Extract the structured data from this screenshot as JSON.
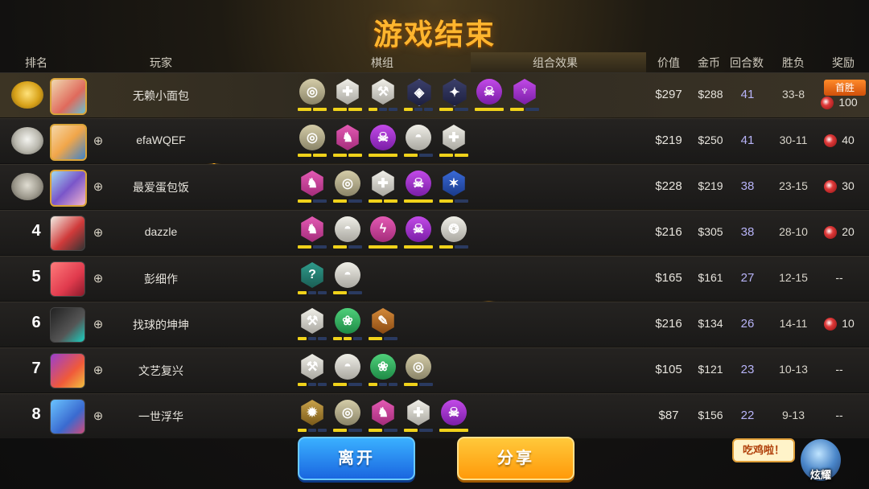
{
  "title": "游戏结束",
  "headers": {
    "rank": "排名",
    "player": "玩家",
    "pieces": "棋组",
    "combo": "组合效果",
    "value": "价值",
    "gold": "金币",
    "rounds": "回合数",
    "winloss": "胜负",
    "reward": "奖励"
  },
  "players": [
    {
      "rank": "1",
      "name": "无赖小面包",
      "value": "$297",
      "gold": "$288",
      "rounds": "41",
      "winloss": "33-8",
      "reward": "100",
      "first_win": "首胜",
      "synergies": [
        {
          "icon": "mech-icon",
          "glyph": "◎",
          "color": "c-bronze",
          "shape": "circle",
          "pips": [
            1,
            1
          ]
        },
        {
          "icon": "knight-icon",
          "glyph": "✚",
          "color": "c-silver",
          "shape": "hex",
          "pips": [
            1,
            1
          ]
        },
        {
          "icon": "axe-icon",
          "glyph": "⚒",
          "color": "c-silver",
          "shape": "hex",
          "pips": [
            1,
            0,
            0
          ]
        },
        {
          "icon": "mage-icon",
          "glyph": "◈",
          "color": "c-dark",
          "shape": "hex",
          "pips": [
            1,
            0,
            0
          ]
        },
        {
          "icon": "assassin-icon",
          "glyph": "✦",
          "color": "c-dark",
          "shape": "hex",
          "pips": [
            1,
            0
          ]
        },
        {
          "icon": "demon-icon",
          "glyph": "☠",
          "color": "c-purple",
          "shape": "circle",
          "pips": [
            1
          ]
        },
        {
          "icon": "warlock-icon",
          "glyph": "♆",
          "color": "c-purple",
          "shape": "hex",
          "pips": [
            1,
            0
          ]
        }
      ]
    },
    {
      "rank": "2",
      "name": "efaWQEF",
      "value": "$219",
      "gold": "$250",
      "rounds": "41",
      "winloss": "30-11",
      "reward": "40",
      "synergies": [
        {
          "icon": "mech-icon",
          "glyph": "◎",
          "color": "c-bronze",
          "shape": "circle",
          "pips": [
            1,
            1
          ]
        },
        {
          "icon": "horse-icon",
          "glyph": "♞",
          "color": "c-pink",
          "shape": "hex",
          "pips": [
            1,
            1
          ]
        },
        {
          "icon": "demon-icon",
          "glyph": "☠",
          "color": "c-purple",
          "shape": "circle",
          "pips": [
            1
          ]
        },
        {
          "icon": "helmet-icon",
          "glyph": "◓",
          "color": "c-silver",
          "shape": "circle",
          "pips": [
            1,
            0
          ]
        },
        {
          "icon": "knight-icon",
          "glyph": "✚",
          "color": "c-silver",
          "shape": "hex",
          "pips": [
            1,
            1
          ]
        }
      ]
    },
    {
      "rank": "3",
      "name": "最爱蛋包饭",
      "value": "$228",
      "gold": "$219",
      "rounds": "38",
      "winloss": "23-15",
      "reward": "30",
      "synergies": [
        {
          "icon": "horse-icon",
          "glyph": "♞",
          "color": "c-pink",
          "shape": "hex",
          "pips": [
            1,
            0
          ]
        },
        {
          "icon": "mech-icon",
          "glyph": "◎",
          "color": "c-bronze",
          "shape": "circle",
          "pips": [
            1,
            0
          ]
        },
        {
          "icon": "knight-icon",
          "glyph": "✚",
          "color": "c-silver",
          "shape": "hex",
          "pips": [
            1,
            1
          ]
        },
        {
          "icon": "demon-icon",
          "glyph": "☠",
          "color": "c-purple",
          "shape": "circle",
          "pips": [
            1
          ]
        },
        {
          "icon": "hunter-icon",
          "glyph": "✶",
          "color": "c-blue",
          "shape": "hex",
          "pips": [
            1,
            0
          ]
        }
      ]
    },
    {
      "rank": "4",
      "name": "dazzle",
      "value": "$216",
      "gold": "$305",
      "rounds": "38",
      "winloss": "28-10",
      "reward": "20",
      "synergies": [
        {
          "icon": "horse-icon",
          "glyph": "♞",
          "color": "c-pink",
          "shape": "hex",
          "pips": [
            1,
            0
          ]
        },
        {
          "icon": "helmet-icon",
          "glyph": "◓",
          "color": "c-silver",
          "shape": "circle",
          "pips": [
            1,
            0
          ]
        },
        {
          "icon": "dragon-icon",
          "glyph": "ϟ",
          "color": "c-pink",
          "shape": "circle",
          "pips": [
            1
          ]
        },
        {
          "icon": "demon-icon",
          "glyph": "☠",
          "color": "c-purple",
          "shape": "circle",
          "pips": [
            1
          ]
        },
        {
          "icon": "orb-icon",
          "glyph": "❂",
          "color": "c-silver",
          "shape": "circle",
          "pips": [
            1,
            0
          ]
        }
      ]
    },
    {
      "rank": "5",
      "name": "彭细作",
      "value": "$165",
      "gold": "$161",
      "rounds": "27",
      "winloss": "12-15",
      "reward": "--",
      "synergies": [
        {
          "icon": "mystery-icon",
          "glyph": "?",
          "color": "c-teal",
          "shape": "hex",
          "pips": [
            1,
            0,
            0
          ]
        },
        {
          "icon": "helmet-icon",
          "glyph": "◓",
          "color": "c-silver",
          "shape": "circle",
          "pips": [
            1,
            0
          ]
        }
      ]
    },
    {
      "rank": "6",
      "name": "找球的坤坤",
      "value": "$216",
      "gold": "$134",
      "rounds": "26",
      "winloss": "14-11",
      "reward": "10",
      "synergies": [
        {
          "icon": "axe-icon",
          "glyph": "⚒",
          "color": "c-silver",
          "shape": "hex",
          "pips": [
            1,
            0,
            0
          ]
        },
        {
          "icon": "paw-icon",
          "glyph": "❀",
          "color": "c-green",
          "shape": "circle",
          "pips": [
            1,
            1,
            0
          ]
        },
        {
          "icon": "feather-icon",
          "glyph": "✎",
          "color": "c-orange",
          "shape": "hex",
          "pips": [
            1,
            0
          ]
        }
      ]
    },
    {
      "rank": "7",
      "name": "文艺复兴",
      "value": "$105",
      "gold": "$121",
      "rounds": "23",
      "winloss": "10-13",
      "reward": "--",
      "synergies": [
        {
          "icon": "axe-icon",
          "glyph": "⚒",
          "color": "c-silver",
          "shape": "hex",
          "pips": [
            1,
            0,
            0
          ]
        },
        {
          "icon": "helmet-icon",
          "glyph": "◓",
          "color": "c-silver",
          "shape": "circle",
          "pips": [
            1,
            0
          ]
        },
        {
          "icon": "paw-icon",
          "glyph": "❀",
          "color": "c-green",
          "shape": "circle",
          "pips": [
            1,
            0,
            0
          ]
        },
        {
          "icon": "mech-icon",
          "glyph": "◎",
          "color": "c-bronze",
          "shape": "circle",
          "pips": [
            1,
            0
          ]
        }
      ]
    },
    {
      "rank": "8",
      "name": "一世浮华",
      "value": "$87",
      "gold": "$156",
      "rounds": "22",
      "winloss": "9-13",
      "reward": "--",
      "synergies": [
        {
          "icon": "gear-icon",
          "glyph": "✹",
          "color": "c-gold",
          "shape": "hex",
          "pips": [
            1,
            0,
            0
          ]
        },
        {
          "icon": "mech-icon",
          "glyph": "◎",
          "color": "c-bronze",
          "shape": "circle",
          "pips": [
            1,
            0
          ]
        },
        {
          "icon": "horse-icon",
          "glyph": "♞",
          "color": "c-pink",
          "shape": "hex",
          "pips": [
            1,
            0
          ]
        },
        {
          "icon": "knight-icon",
          "glyph": "✚",
          "color": "c-silver",
          "shape": "hex",
          "pips": [
            1,
            0
          ]
        },
        {
          "icon": "demon-icon",
          "glyph": "☠",
          "color": "c-purple",
          "shape": "circle",
          "pips": [
            1
          ]
        }
      ]
    }
  ],
  "buttons": {
    "leave": "离开",
    "share": "分享"
  },
  "bubble": "吃鸡啦！",
  "show_off": "炫耀",
  "colors": {
    "title": "#ffb52e",
    "rounds": "#b8b4f8",
    "pip_on": "#f0d21a",
    "pip_off": "#2a3a60",
    "leave": "#1a66e0",
    "share": "#ff9a0a"
  }
}
